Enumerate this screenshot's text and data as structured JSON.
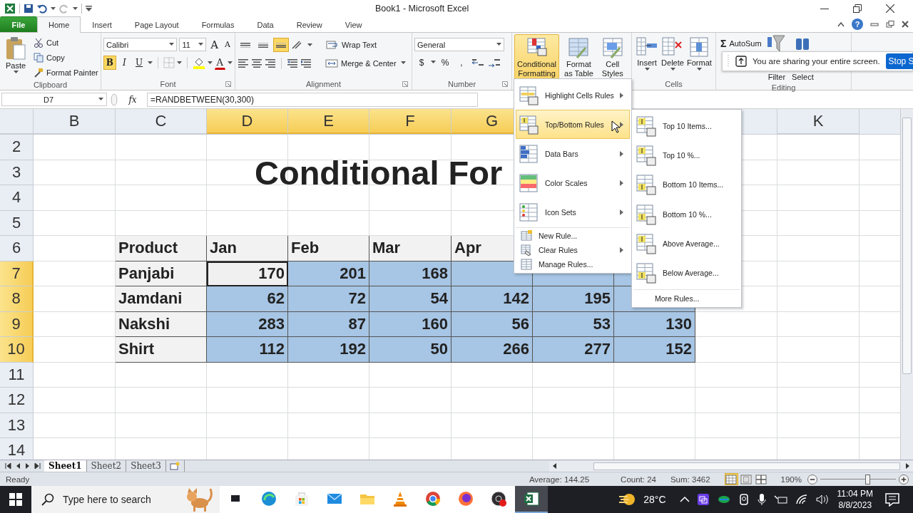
{
  "window": {
    "title": "Book1  -  Microsoft Excel",
    "help": "?"
  },
  "ribbon_tabs": [
    {
      "label": "File",
      "kind": "file",
      "selected": false
    },
    {
      "label": "Home",
      "kind": "tab",
      "selected": true
    },
    {
      "label": "Insert",
      "kind": "tab",
      "selected": false
    },
    {
      "label": "Page Layout",
      "kind": "tab",
      "selected": false
    },
    {
      "label": "Formulas",
      "kind": "tab",
      "selected": false
    },
    {
      "label": "Data",
      "kind": "tab",
      "selected": false
    },
    {
      "label": "Review",
      "kind": "tab",
      "selected": false
    },
    {
      "label": "View",
      "kind": "tab",
      "selected": false
    }
  ],
  "clipboard": {
    "paste": "Paste",
    "cut": "Cut",
    "copy": "Copy",
    "format_painter": "Format Painter",
    "label": "Clipboard"
  },
  "font": {
    "name": "Calibri",
    "size": "11",
    "grow": "A",
    "shrink": "A",
    "bold": {
      "label": "B",
      "on": true
    },
    "italic": {
      "label": "I",
      "on": false
    },
    "underline": {
      "label": "U",
      "on": false
    },
    "color_button": "A",
    "label": "Font"
  },
  "alignment": {
    "vertical": [
      {
        "kind": "top",
        "on": false
      },
      {
        "kind": "middle",
        "on": false
      },
      {
        "kind": "bottom",
        "on": true
      }
    ],
    "wrap_text": "Wrap Text",
    "merge_center": "Merge & Center",
    "label": "Alignment"
  },
  "number": {
    "format": "General",
    "currency": "$",
    "percent": "%",
    "comma": ",",
    "label": "Number"
  },
  "styles": [
    {
      "lines": [
        "Conditional",
        "Formatting"
      ],
      "kind": "conditional",
      "selected": true
    },
    {
      "lines": [
        "Format",
        "as Table"
      ],
      "kind": "table",
      "selected": false
    },
    {
      "lines": [
        "Cell",
        "Styles"
      ],
      "kind": "cellstyles",
      "selected": false
    }
  ],
  "cells": {
    "buttons": [
      {
        "label": "Insert",
        "kind": "insert"
      },
      {
        "label": "Delete",
        "kind": "delete"
      },
      {
        "label": "Format",
        "kind": "format"
      }
    ],
    "label": "Cells"
  },
  "editing": {
    "sigma": "Σ",
    "autosum": "AutoSum",
    "filter": "Filter",
    "select": "Select",
    "label": "Editing"
  },
  "share_banner": {
    "message": "You are sharing your entire screen.",
    "button": "Stop S"
  },
  "formula_bar": {
    "name_box": "D7",
    "fx": "fx",
    "formula": "=RANDBETWEEN(30,300)"
  },
  "sheet": {
    "column_headers_left": [
      {
        "label": "B",
        "selected": false
      },
      {
        "label": "C",
        "selected": false
      },
      {
        "label": "D",
        "selected": true
      },
      {
        "label": "E",
        "selected": true
      },
      {
        "label": "F",
        "selected": true
      },
      {
        "label": "G",
        "selected": true
      }
    ],
    "column_headers_right": [
      {
        "label": "K",
        "selected": false
      }
    ],
    "rows": [
      {
        "header": {
          "label": "2",
          "selected": false
        },
        "kind": "blank"
      },
      {
        "header": {
          "label": "3",
          "selected": false
        },
        "kind": "title",
        "title": "Conditional For"
      },
      {
        "header": {
          "label": "4",
          "selected": false
        },
        "kind": "blank"
      },
      {
        "header": {
          "label": "5",
          "selected": false
        },
        "kind": "blank"
      },
      {
        "header": {
          "label": "6",
          "selected": false
        },
        "kind": "table_header",
        "cells": [
          {
            "text": "Product",
            "selected": false
          },
          {
            "text": "Jan",
            "selected": false
          },
          {
            "text": "Feb",
            "selected": false
          },
          {
            "text": "Mar",
            "selected": false
          },
          {
            "text": "Apr",
            "selected": false
          }
        ]
      },
      {
        "header": {
          "label": "7",
          "selected": true
        },
        "kind": "data",
        "cells": [
          {
            "text": "Panjabi",
            "selected": false
          },
          {
            "text": "170",
            "selected": true,
            "active": true
          },
          {
            "text": "201",
            "selected": true
          },
          {
            "text": "168",
            "selected": true
          },
          {
            "selected": true
          },
          {
            "selected": true
          },
          {
            "selected": true
          }
        ]
      },
      {
        "header": {
          "label": "8",
          "selected": true
        },
        "kind": "data",
        "cells": [
          {
            "text": "Jamdani",
            "selected": false
          },
          {
            "text": "62",
            "selected": true
          },
          {
            "text": "72",
            "selected": true
          },
          {
            "text": "54",
            "selected": true
          },
          {
            "text": "142",
            "selected": true
          },
          {
            "text": "195",
            "selected": true
          },
          {
            "selected": true
          }
        ]
      },
      {
        "header": {
          "label": "9",
          "selected": true
        },
        "kind": "data",
        "cells": [
          {
            "text": "Nakshi",
            "selected": false
          },
          {
            "text": "283",
            "selected": true
          },
          {
            "text": "87",
            "selected": true
          },
          {
            "text": "160",
            "selected": true
          },
          {
            "text": "56",
            "selected": true
          },
          {
            "text": "53",
            "selected": true
          },
          {
            "text": "130",
            "selected": true
          }
        ]
      },
      {
        "header": {
          "label": "10",
          "selected": true
        },
        "kind": "data",
        "cells": [
          {
            "text": "Shirt",
            "selected": false
          },
          {
            "text": "112",
            "selected": true
          },
          {
            "text": "192",
            "selected": true
          },
          {
            "text": "50",
            "selected": true
          },
          {
            "text": "266",
            "selected": true
          },
          {
            "text": "277",
            "selected": true
          },
          {
            "text": "152",
            "selected": true
          }
        ]
      },
      {
        "header": {
          "label": "11",
          "selected": false
        },
        "kind": "blank"
      },
      {
        "header": {
          "label": "12",
          "selected": false
        },
        "kind": "blank"
      },
      {
        "header": {
          "label": "13",
          "selected": false
        },
        "kind": "blank"
      },
      {
        "header": {
          "label": "14",
          "selected": false
        },
        "kind": "blank"
      }
    ]
  },
  "cf_menu": {
    "items": [
      {
        "label": "Highlight Cells Rules",
        "kind": "highlight",
        "submenu": true,
        "selected": false
      },
      {
        "label": "Top/Bottom Rules",
        "kind": "topbottom",
        "submenu": true,
        "selected": true
      },
      {
        "label": "Data Bars",
        "kind": "databars",
        "submenu": true,
        "selected": false
      },
      {
        "label": "Color Scales",
        "kind": "colorscales",
        "submenu": true,
        "selected": false
      },
      {
        "label": "Icon Sets",
        "kind": "iconsets",
        "submenu": true,
        "selected": false
      },
      {
        "label": "New Rule...",
        "kind": "newrule",
        "submenu": false,
        "selected": false
      },
      {
        "label": "Clear Rules",
        "kind": "clear",
        "submenu": true,
        "selected": false
      },
      {
        "label": "Manage Rules...",
        "kind": "manage",
        "submenu": false,
        "selected": false
      }
    ]
  },
  "submenu": {
    "items": [
      {
        "label": "Top 10 Items...",
        "kind": "top"
      },
      {
        "label": "Top 10 %...",
        "kind": "top"
      },
      {
        "label": "Bottom 10 Items...",
        "kind": "bottom"
      },
      {
        "label": "Bottom 10 %...",
        "kind": "bottom"
      },
      {
        "label": "Above Average...",
        "kind": "top"
      },
      {
        "label": "Below Average...",
        "kind": "bottom"
      }
    ],
    "more": "More Rules..."
  },
  "sheet_tabs": [
    {
      "label": "Sheet1",
      "selected": true
    },
    {
      "label": "Sheet2",
      "selected": false
    },
    {
      "label": "Sheet3",
      "selected": false
    }
  ],
  "status_bar": {
    "ready": "Ready",
    "average": "Average: 144.25",
    "count": "Count: 24",
    "sum": "Sum: 3462",
    "views": [
      {
        "kind": "normal",
        "selected": true
      },
      {
        "kind": "layout",
        "selected": false
      },
      {
        "kind": "break",
        "selected": false
      }
    ],
    "zoom": "190%",
    "zoom_slider": {
      "level": 0.62
    }
  },
  "taskbar": {
    "search_placeholder": "Type here to search",
    "apps": [
      {
        "kind": "taskview",
        "selected": false
      },
      {
        "kind": "edge",
        "selected": false
      },
      {
        "kind": "store",
        "selected": false
      },
      {
        "kind": "mail",
        "selected": false
      },
      {
        "kind": "folder",
        "selected": false
      },
      {
        "kind": "cone",
        "selected": false
      },
      {
        "kind": "chrome",
        "selected": false
      },
      {
        "kind": "firefox",
        "selected": false
      },
      {
        "kind": "obs",
        "selected": false
      },
      {
        "kind": "excel",
        "selected": true
      }
    ],
    "weather": "28°C",
    "time": "11:04 PM",
    "date": "8/8/2023"
  }
}
